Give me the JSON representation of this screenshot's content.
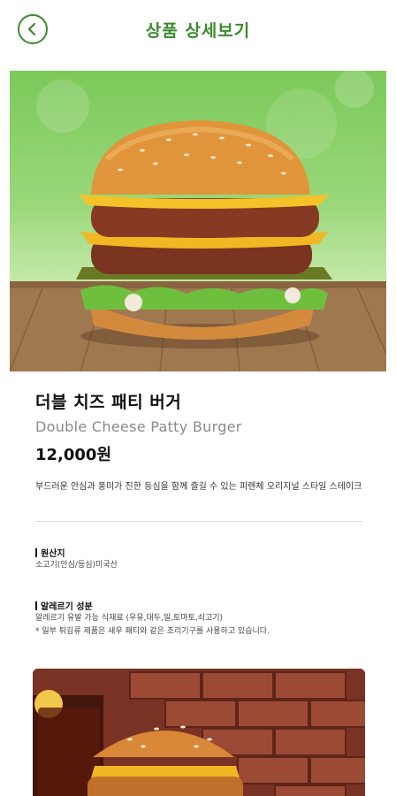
{
  "header": {
    "title": "상품 상세보기",
    "back_icon": "chevron-left-icon",
    "accent_color": "#3c8a2e"
  },
  "product": {
    "name_ko": "더블 치즈 패티 버거",
    "name_en": "Double Cheese Patty Burger",
    "price": "12,000원",
    "description": "부드러운 안심과 풍미가 진한 등심을 함께 즐길 수 있는 피렌체 오리지널 스타일 스테이크"
  },
  "origin": {
    "title": "원산지",
    "text": "소고기(안심/등심)미국산"
  },
  "allergy": {
    "title": "알레르기 성분",
    "line1": "알레르기 유발 가능 식재료 (우유,대두,밀,토마토,쇠고기)",
    "line2": "* 일부 튀김류 제품은 새우 패티와 같은 조리기구를 사용하고 있습니다."
  }
}
